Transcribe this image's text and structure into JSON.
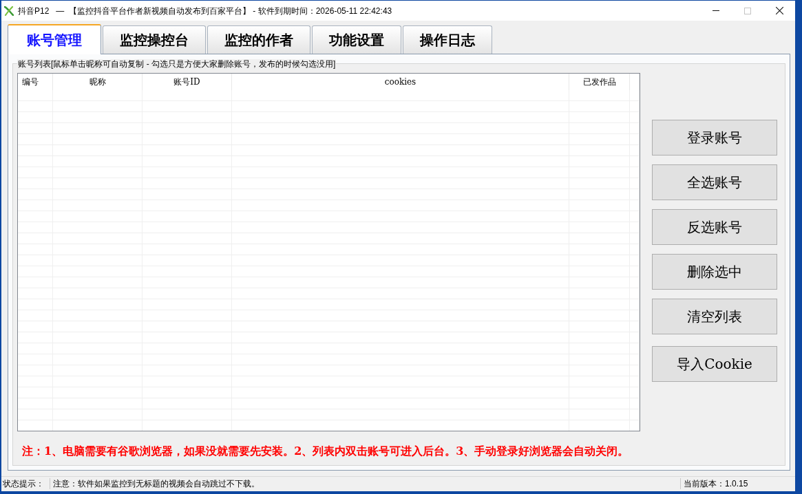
{
  "window": {
    "title": "抖音P12   —  【监控抖音平台作者新视频自动发布到百家平台】 - 软件到期时间：2026-05-11 22:42:43",
    "controls": [
      {
        "kind": "minimize",
        "disabled": false
      },
      {
        "kind": "maximize",
        "disabled": true
      },
      {
        "kind": "close",
        "disabled": false
      }
    ]
  },
  "tabs": [
    {
      "label": "账号管理",
      "selected": true
    },
    {
      "label": "监控操控台",
      "selected": false
    },
    {
      "label": "监控的作者",
      "selected": false
    },
    {
      "label": "功能设置",
      "selected": false
    },
    {
      "label": "操作日志",
      "selected": false
    }
  ],
  "account_list": {
    "caption": "账号列表[鼠标单击昵称可自动复制 - 勾选只是方便大家删除账号，发布的时候勾选没用]",
    "columns": [
      "编号",
      "昵称",
      "账号ID",
      "cookies",
      "已发作品"
    ]
  },
  "buttons": [
    "登录账号",
    "全选账号",
    "反选账号",
    "删除选中",
    "清空列表",
    "导入Cookie"
  ],
  "notice": "注：1、电脑需要有谷歌浏览器，如果没就需要先安装。2、列表内双击账号可进入后台。3、手动登录好浏览器会自动关闭。",
  "status_bar": {
    "label": "状态提示：",
    "message": "注意：软件如果监控到无标题的视频会自动跳过不下载。",
    "version": "当前版本：1.0.15"
  }
}
